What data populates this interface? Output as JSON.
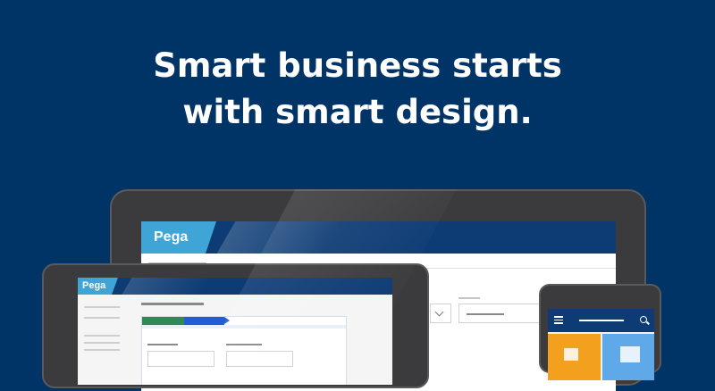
{
  "headline": {
    "line1": "Smart business starts",
    "line2": "with smart design."
  },
  "brand": {
    "logo_text": "Pega"
  },
  "colors": {
    "background": "#003366",
    "header_bar": "#0d3b74",
    "logo_tab": "#3fa5d7",
    "step_done": "#2e8b57",
    "step_active": "#1f5fd1",
    "tile_orange": "#f2a01e",
    "tile_blue": "#5fa9e8",
    "device_frame": "#3b3b3d"
  },
  "icons": {
    "phone_menu": "hamburger-menu-icon",
    "phone_search": "search-icon",
    "dropdown": "chevron-down-icon"
  }
}
